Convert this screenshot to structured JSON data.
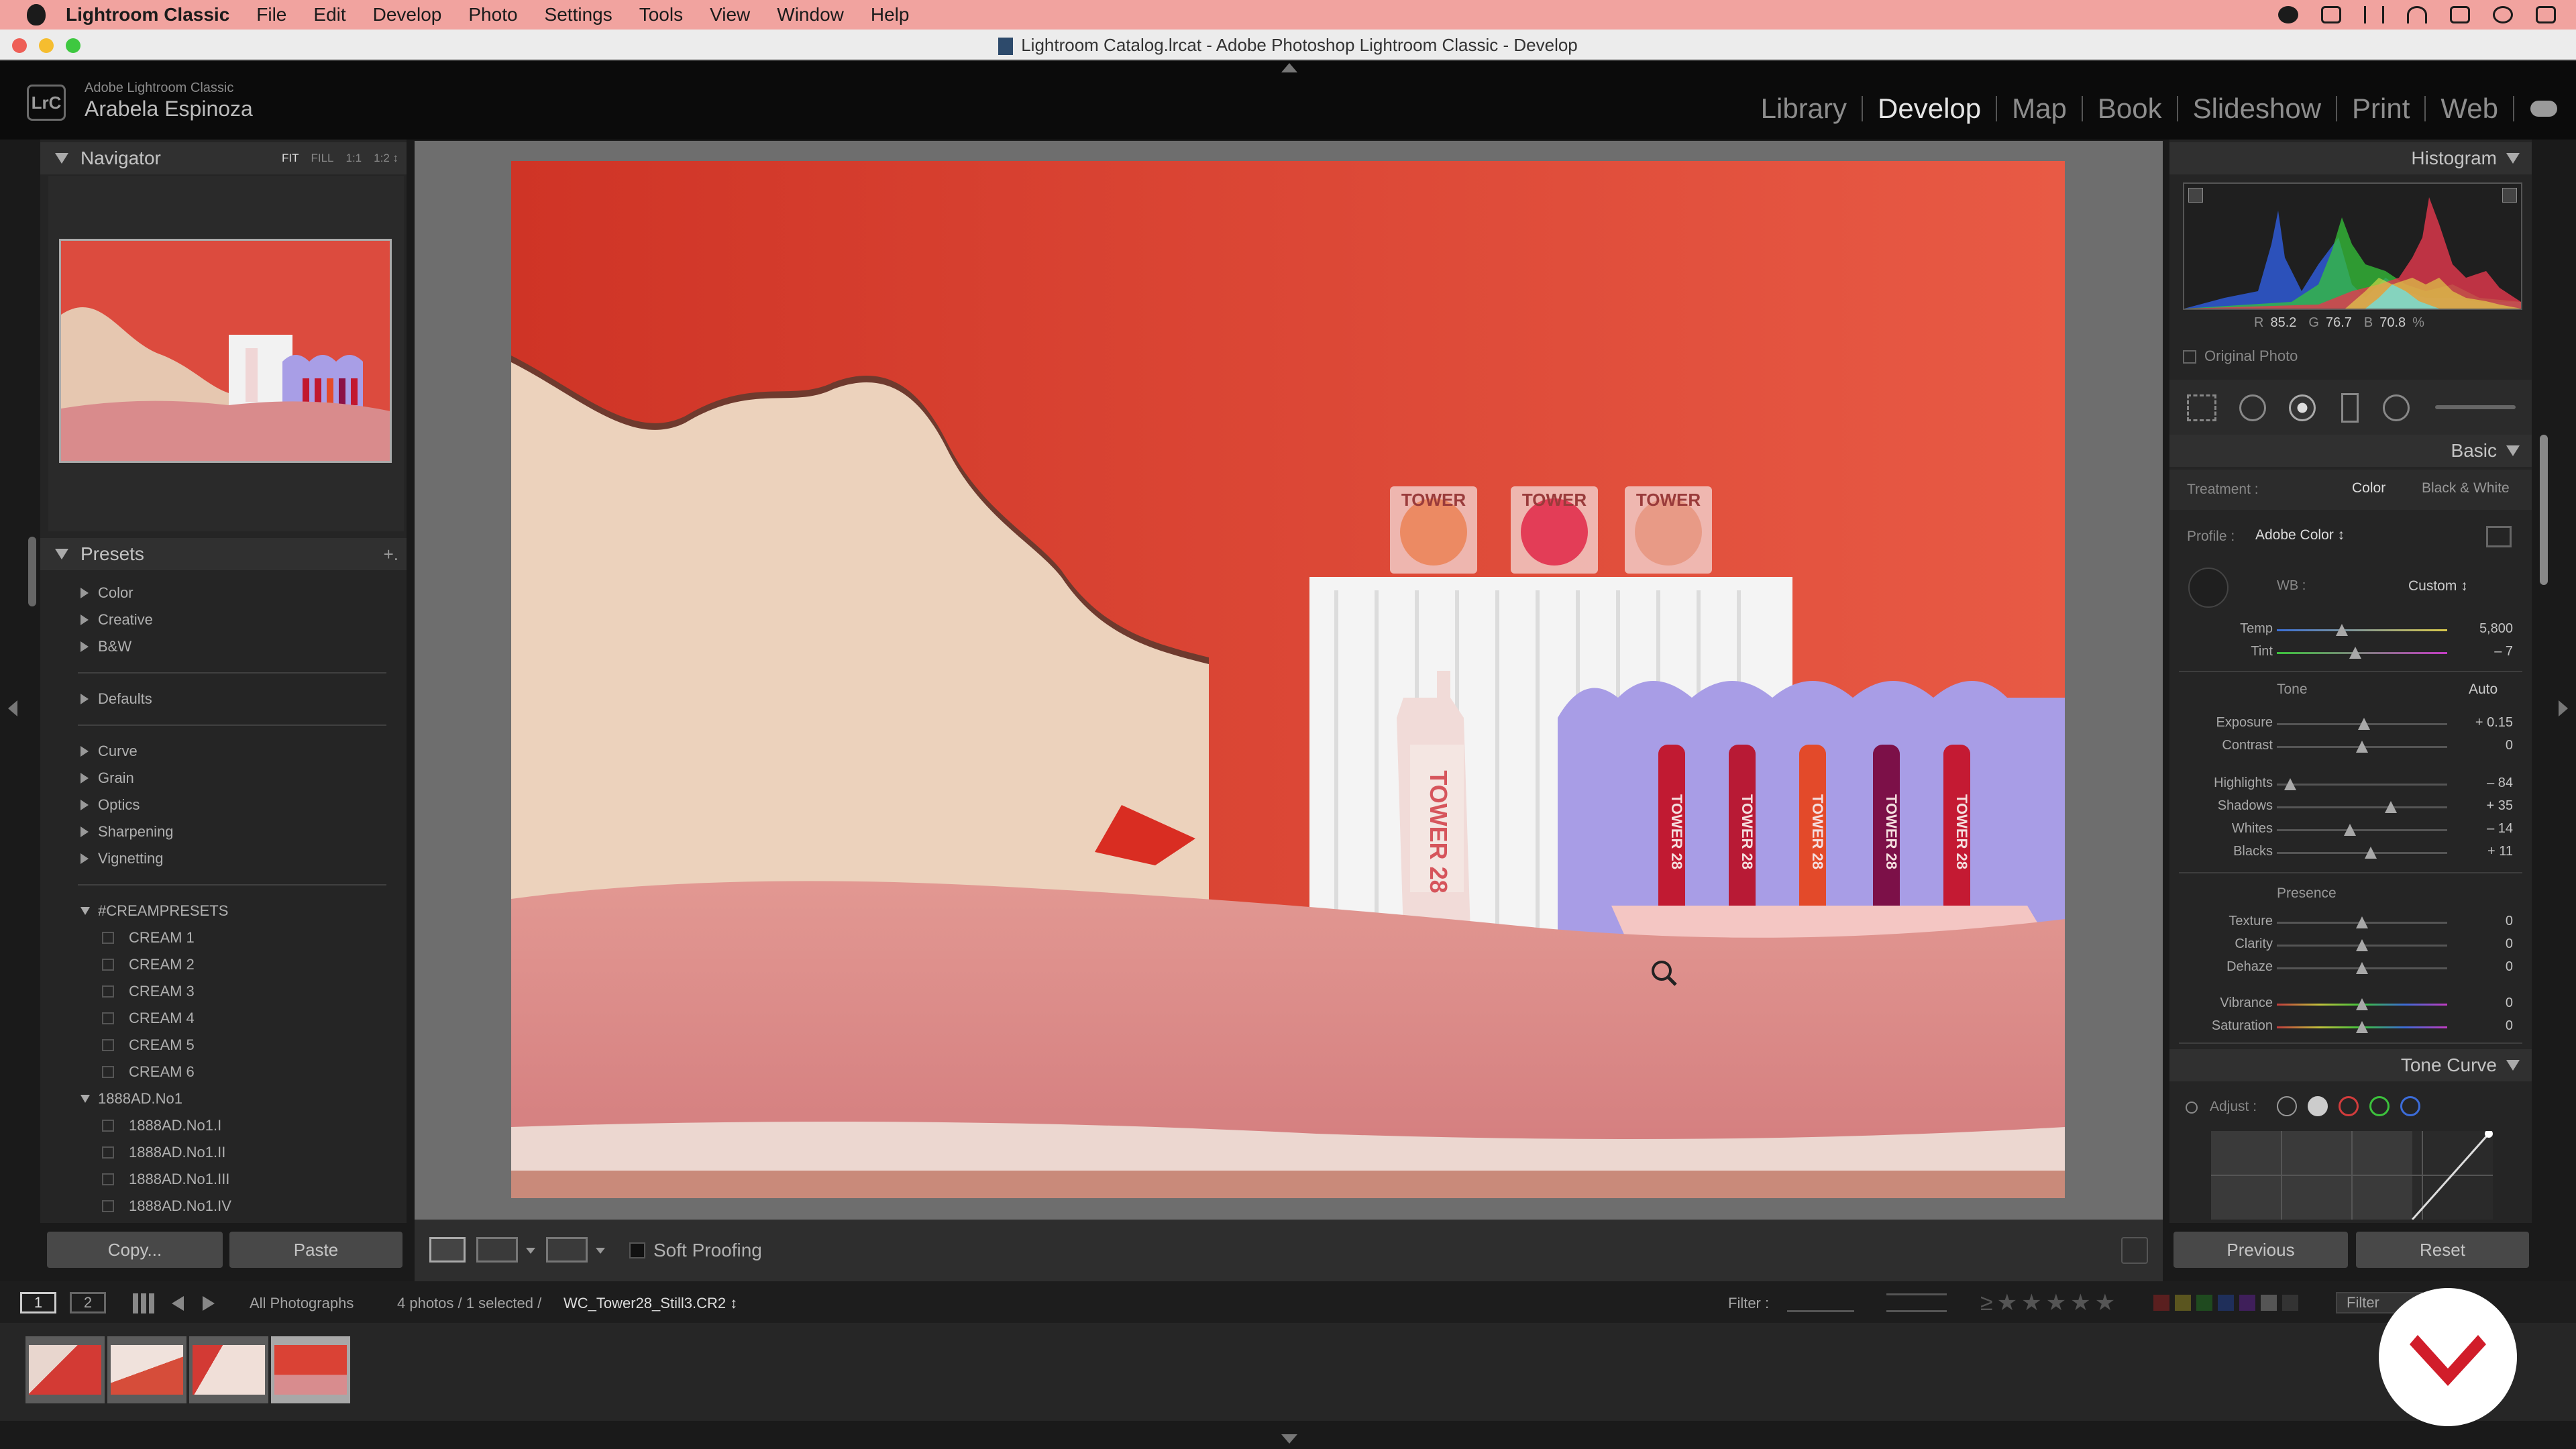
{
  "menubar": {
    "app": "Lightroom Classic",
    "items": [
      "File",
      "Edit",
      "Develop",
      "Photo",
      "Settings",
      "Tools",
      "View",
      "Window",
      "Help"
    ]
  },
  "window_title": "Lightroom Catalog.lrcat - Adobe Photoshop Lightroom Classic - Develop",
  "identity": {
    "badge": "LrC",
    "product": "Adobe Lightroom Classic",
    "user": "Arabela Espinoza"
  },
  "modules": [
    {
      "label": "Library",
      "active": false
    },
    {
      "label": "Develop",
      "active": true
    },
    {
      "label": "Map",
      "active": false
    },
    {
      "label": "Book",
      "active": false
    },
    {
      "label": "Slideshow",
      "active": false
    },
    {
      "label": "Print",
      "active": false
    },
    {
      "label": "Web",
      "active": false
    }
  ],
  "navigator": {
    "title": "Navigator",
    "zoom": [
      "FIT",
      "FILL",
      "1:1",
      "1:2 ↕"
    ]
  },
  "presets": {
    "title": "Presets",
    "add": "+.",
    "groups": [
      "Color",
      "Creative",
      "B&W",
      "Defaults",
      "Curve",
      "Grain",
      "Optics",
      "Sharpening",
      "Vignetting"
    ],
    "cream": {
      "name": "#CREAMPRESETS",
      "items": [
        "CREAM 1",
        "CREAM 2",
        "CREAM 3",
        "CREAM 4",
        "CREAM 5",
        "CREAM 6"
      ]
    },
    "ad": {
      "name": "1888AD.No1",
      "items": [
        "1888AD.No1.I",
        "1888AD.No1.II",
        "1888AD.No1.III",
        "1888AD.No1.IV"
      ]
    }
  },
  "left_buttons": {
    "copy": "Copy...",
    "paste": "Paste"
  },
  "toolbar": {
    "soft_proofing": "Soft Proofing"
  },
  "histogram": {
    "title": "Histogram",
    "r_label": "R",
    "r": "85.2",
    "g_label": "G",
    "g": "76.7",
    "b_label": "B",
    "b": "70.8",
    "pct": "%",
    "original": "Original Photo"
  },
  "basic": {
    "title": "Basic",
    "treatment_label": "Treatment :",
    "color": "Color",
    "bw": "Black & White",
    "profile_label": "Profile :",
    "profile": "Adobe Color ↕",
    "wb_label": "WB :",
    "wb": "Custom ↕",
    "tone": "Tone",
    "auto": "Auto",
    "presence": "Presence",
    "sliders": {
      "temp": {
        "label": "Temp",
        "value": "5,800",
        "pos": 0.38
      },
      "tint": {
        "label": "Tint",
        "value": "– 7",
        "pos": 0.46
      },
      "exposure": {
        "label": "Exposure",
        "value": "+ 0.15",
        "pos": 0.51
      },
      "contrast": {
        "label": "Contrast",
        "value": "0",
        "pos": 0.5
      },
      "highlights": {
        "label": "Highlights",
        "value": "– 84",
        "pos": 0.08
      },
      "shadows": {
        "label": "Shadows",
        "value": "+ 35",
        "pos": 0.67
      },
      "whites": {
        "label": "Whites",
        "value": "– 14",
        "pos": 0.43
      },
      "blacks": {
        "label": "Blacks",
        "value": "+ 11",
        "pos": 0.55
      },
      "texture": {
        "label": "Texture",
        "value": "0",
        "pos": 0.5
      },
      "clarity": {
        "label": "Clarity",
        "value": "0",
        "pos": 0.5
      },
      "dehaze": {
        "label": "Dehaze",
        "value": "0",
        "pos": 0.5
      },
      "vibrance": {
        "label": "Vibrance",
        "value": "0",
        "pos": 0.5
      },
      "saturation": {
        "label": "Saturation",
        "value": "0",
        "pos": 0.5
      }
    }
  },
  "tone_curve": {
    "title": "Tone Curve",
    "adjust": "Adjust :"
  },
  "right_buttons": {
    "previous": "Previous",
    "reset": "Reset"
  },
  "filmbar": {
    "page1": "1",
    "page2": "2",
    "source": "All Photographs",
    "count": "4 photos / 1 selected /",
    "file": "WC_Tower28_Still3.CR2 ↕",
    "filter": "Filter :",
    "filter_btn": "Filter"
  },
  "product_text": "TOWER 28",
  "cap_text": "TOWER"
}
